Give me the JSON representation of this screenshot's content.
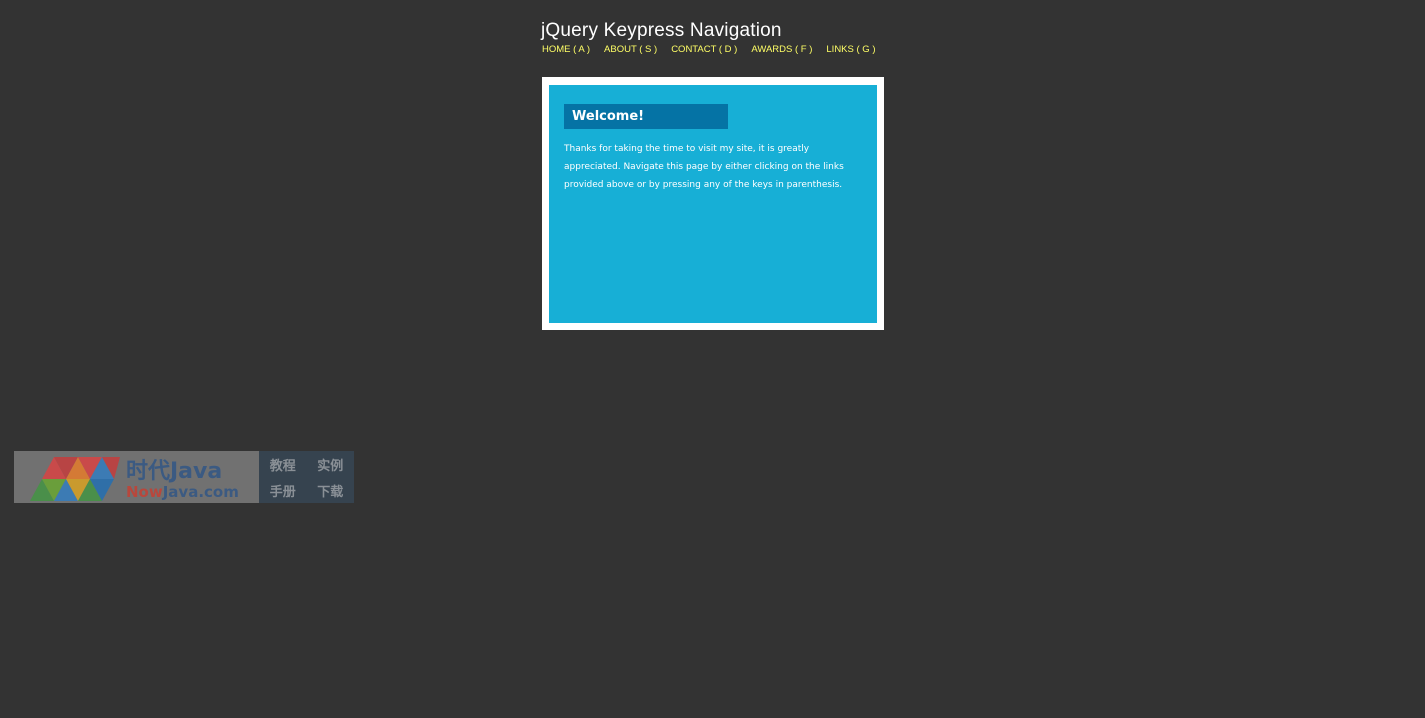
{
  "header": {
    "title": "jQuery Keypress Navigation"
  },
  "nav": {
    "items": [
      {
        "label": "HOME ( A )"
      },
      {
        "label": "ABOUT ( S )"
      },
      {
        "label": "CONTACT ( D )"
      },
      {
        "label": "AWARDS ( F )"
      },
      {
        "label": "LINKS ( G )"
      }
    ]
  },
  "panel": {
    "heading": "Welcome!",
    "body": "Thanks for taking the time to visit my site, it is greatly appreciated. Navigate this page by either clicking on the links provided above or by pressing any of the keys in parenthesis."
  },
  "watermark": {
    "brand": "时代Java",
    "url_accent": "Now",
    "url_rest": "Java.com",
    "links": [
      "教程",
      "实例",
      "手册",
      "下载"
    ]
  },
  "colors": {
    "background": "#333333",
    "nav_link": "#ffff66",
    "panel": "#17afd6",
    "panel_heading": "#0573a5"
  }
}
